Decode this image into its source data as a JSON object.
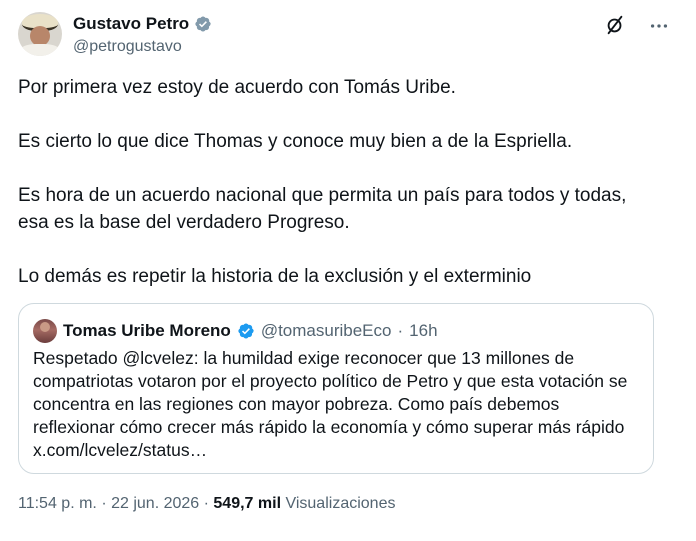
{
  "author": {
    "display_name": "Gustavo Petro",
    "handle": "@petrogustavo",
    "verified_icon": "verified-badge-icon",
    "verified_color": "#1d9bf0"
  },
  "tweet": {
    "paragraphs": [
      "Por primera vez estoy de acuerdo con Tomás Uribe.",
      "Es cierto lo que dice Thomas y conoce muy bien a de la Espriella.",
      "Es hora de un acuerdo nacional que permita un país para todos y todas,\nesa es la base del verdadero Progreso.",
      "Lo demás es repetir la historia de la exclusión y el exterminio"
    ]
  },
  "quote": {
    "display_name": "Tomas Uribe Moreno",
    "handle": "@tomasuribeEco",
    "separator": "·",
    "time": "16h",
    "text": "Respetado @lcvelez: la humildad exige reconocer que 13 millones de compatriotas votaron por el proyecto político de Petro y que esta votación se concentra en las regiones con mayor pobreza. Como país debemos reflexionar cómo crecer más rápido la economía y cómo superar más rápido x.com/lcvelez/status…"
  },
  "meta": {
    "time": "11:54 p. m.",
    "sep1": "·",
    "date": "22 jun. 2026",
    "sep2": "·",
    "views_count": "549,7 mil",
    "views_label": "Visualizaciones"
  },
  "icons": {
    "grok": "grok-icon",
    "more": "more-icon"
  },
  "colors": {
    "text": "#0f1419",
    "secondary": "#536471",
    "border": "#cfd9de",
    "verified": "#1d9bf0"
  }
}
